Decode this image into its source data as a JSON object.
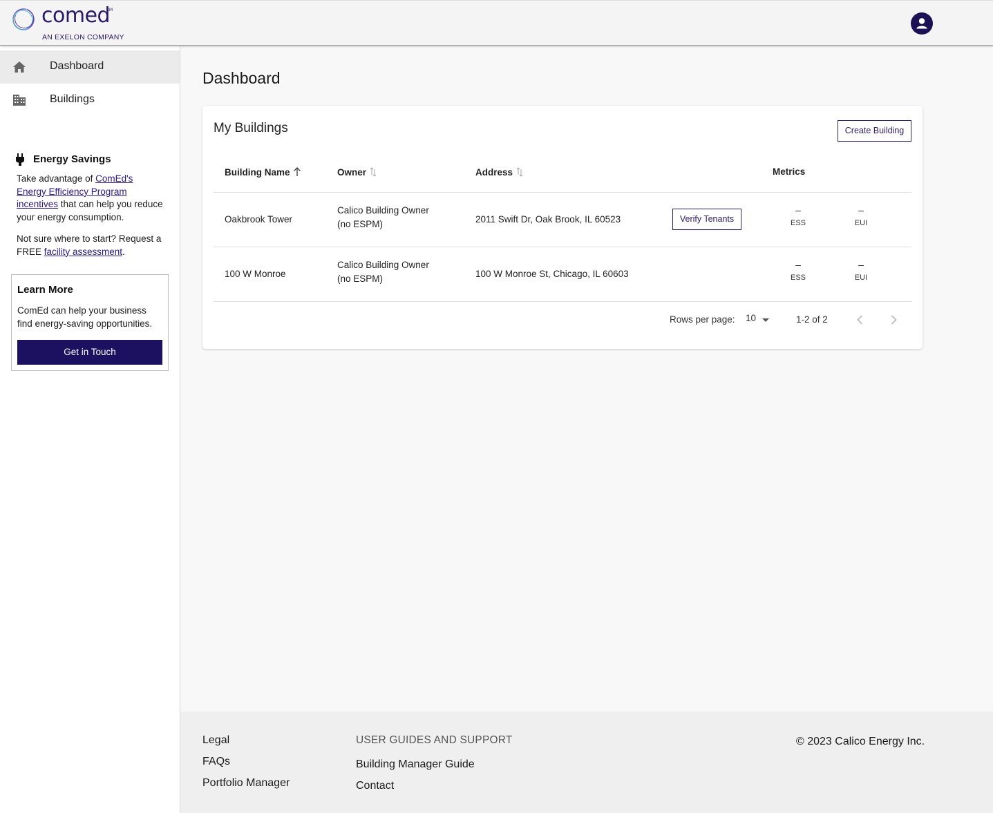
{
  "brand": {
    "name": "comed",
    "mark": "SM",
    "tagline": "AN EXELON COMPANY"
  },
  "header": {
    "avatar_icon": "account-circle-icon"
  },
  "sidebar": {
    "items": [
      {
        "label": "Dashboard",
        "icon": "home-icon",
        "active": true
      },
      {
        "label": "Buildings",
        "icon": "building-icon",
        "active": false
      }
    ],
    "energy_savings": {
      "icon": "plug-icon",
      "title": "Energy Savings",
      "text_prefix": "Take advantage of ",
      "link1": "ComEd's Energy Efficiency Program incentives",
      "text_suffix": " that can help you reduce your energy consumption.",
      "text2_prefix": "Not sure where to start? Request a FREE ",
      "link2": "facility assessment",
      "text2_suffix": "."
    },
    "learn_more": {
      "title": "Learn More",
      "text": "ComEd can help your business find energy-saving opportunities.",
      "button": "Get in Touch"
    }
  },
  "main": {
    "title": "Dashboard",
    "card": {
      "title": "My Buildings",
      "create_button": "Create Building",
      "columns": {
        "name": "Building Name",
        "owner": "Owner",
        "address": "Address",
        "metrics": "Metrics"
      },
      "rows": [
        {
          "name": "Oakbrook Tower",
          "owner_line1": "Calico Building Owner",
          "owner_line2": "(no ESPM)",
          "address": "2011 Swift Dr, Oak Brook, IL 60523",
          "action": "Verify Tenants",
          "ess_value": "–",
          "ess_label": "ESS",
          "eui_value": "–",
          "eui_label": "EUI"
        },
        {
          "name": "100 W Monroe",
          "owner_line1": "Calico Building Owner",
          "owner_line2": "(no ESPM)",
          "address": "100 W Monroe St, Chicago, IL 60603",
          "action": "",
          "ess_value": "–",
          "ess_label": "ESS",
          "eui_value": "–",
          "eui_label": "EUI"
        }
      ],
      "pagination": {
        "rows_label": "Rows per page:",
        "rows_value": "10",
        "range": "1-2 of 2"
      }
    }
  },
  "footer": {
    "links_col1": [
      "Legal",
      "FAQs",
      "Portfolio Manager"
    ],
    "section_heading": "USER GUIDES AND SUPPORT",
    "links_col2": [
      "Building Manager Guide",
      "Contact"
    ],
    "copyright": "© 2023 Calico Energy Inc."
  },
  "colors": {
    "brand_purple": "#2b1a63",
    "button_dark": "#1c1060",
    "active_nav": "#ebebeb"
  }
}
